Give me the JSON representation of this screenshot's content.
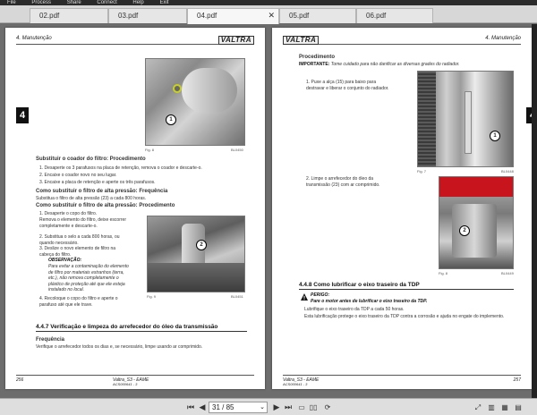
{
  "menu": [
    "File",
    "Process",
    "Share",
    "Connect",
    "Help",
    "Exit"
  ],
  "tabs": [
    {
      "label": "02.pdf",
      "active": false
    },
    {
      "label": "03.pdf",
      "active": false
    },
    {
      "label": "04.pdf",
      "active": true
    },
    {
      "label": "05.pdf",
      "active": false
    },
    {
      "label": "06.pdf",
      "active": false
    }
  ],
  "left_page": {
    "header_left": "4. Manutenção",
    "logo": "VALTRA",
    "chapter": "4",
    "fig_label": "Fig. 8",
    "fig_code": "BL0450",
    "callout": "1",
    "h1": "Substituir o coador do filtro: Procedimento",
    "steps1": [
      "1.  Desaperte os 3 parafusos na placa de retenção, remova o coador e descarte-o.",
      "2.  Encaixe o coador novo no seu lugar.",
      "3.  Encaixe a placa de retenção e aperte os três parafusos."
    ],
    "h2": "Como substituir o filtro de alta pressão: Frequência",
    "p2": "Substitua o filtro de alta pressão (23) a cada 800 horas.",
    "h3": "Como substituir o filtro de alta pressão: Procedimento",
    "steps2": [
      "1.  Desaperte o copo do filtro.",
      "    Remova o elemento do filtro, deixe escorrer completamente e descarte-o.",
      "2.  Substitua o selo a cada 800 horas, ou quando necessário.",
      "3.  Deslize o novo elemento de filtro na cabeça do filtro."
    ],
    "obs_title": "OBSERVAÇÃO:",
    "obs_text": "Para evitar a contaminação do elemento de filtro por materiais estranhos (terra, etc.), não remova completamente o plástico de proteção até que ele esteja instalado no local.",
    "step4": "4.  Recoloque o copo do filtro e aperte o parafuso até que ele trave.",
    "fig2_label": "Fig. 9",
    "fig2_code": "BL0451",
    "callout2": "2",
    "section": "4.4.7   Verificação e limpeza do arrefecedor do óleo da transmissão",
    "freq_title": "Frequência",
    "freq_text": "Verifique o arrefecedor todos os dias e, se necessário, limpe usando ar comprimido.",
    "footer_left": "256",
    "footer_mid": "Valtra_S3 - EAME",
    "footer_code": "ACS000641 - 3"
  },
  "right_page": {
    "logo": "VALTRA",
    "header_right": "4. Manutenção",
    "chapter": "4",
    "proc_title": "Procedimento",
    "important_label": "IMPORTANTE:",
    "important_text": "Tome cuidado para não danificar as diversas grades do radiador.",
    "steps": [
      "1.  Puxe a alça (15) para baixo para destravar e liberar o conjunto do radiador.",
      "2.  Limpe o arrefecedor do óleo da transmissão (23) com ar comprimido."
    ],
    "fig_label": "Fig. 7",
    "fig_code": "BL0448",
    "callout": "1",
    "fig2_label": "Fig. 8",
    "fig2_code": "BL0449",
    "callout2": "2",
    "section": "4.4.8   Como lubrificar o eixo traseiro da TDP",
    "danger_label": "PERIGO:",
    "danger_text": "Pare o motor antes de lubrificar o eixo traseiro da TDP.",
    "p1": "Lubrifique o eixo traseiro da TDP a cada 50 horas.",
    "p2": "Esta lubrificação protege o eixo traseiro da TDP contra a corrosão e ajuda no engate do implemento.",
    "footer_mid": "Valtra_S3 - EAME",
    "footer_code": "ACS000641 - 3",
    "footer_right": "257"
  },
  "toolbar": {
    "page_value": "31 / 85",
    "first_icon": "first-page-icon",
    "prev_icon": "prev-page-icon",
    "next_icon": "next-page-icon",
    "last_icon": "last-page-icon"
  }
}
